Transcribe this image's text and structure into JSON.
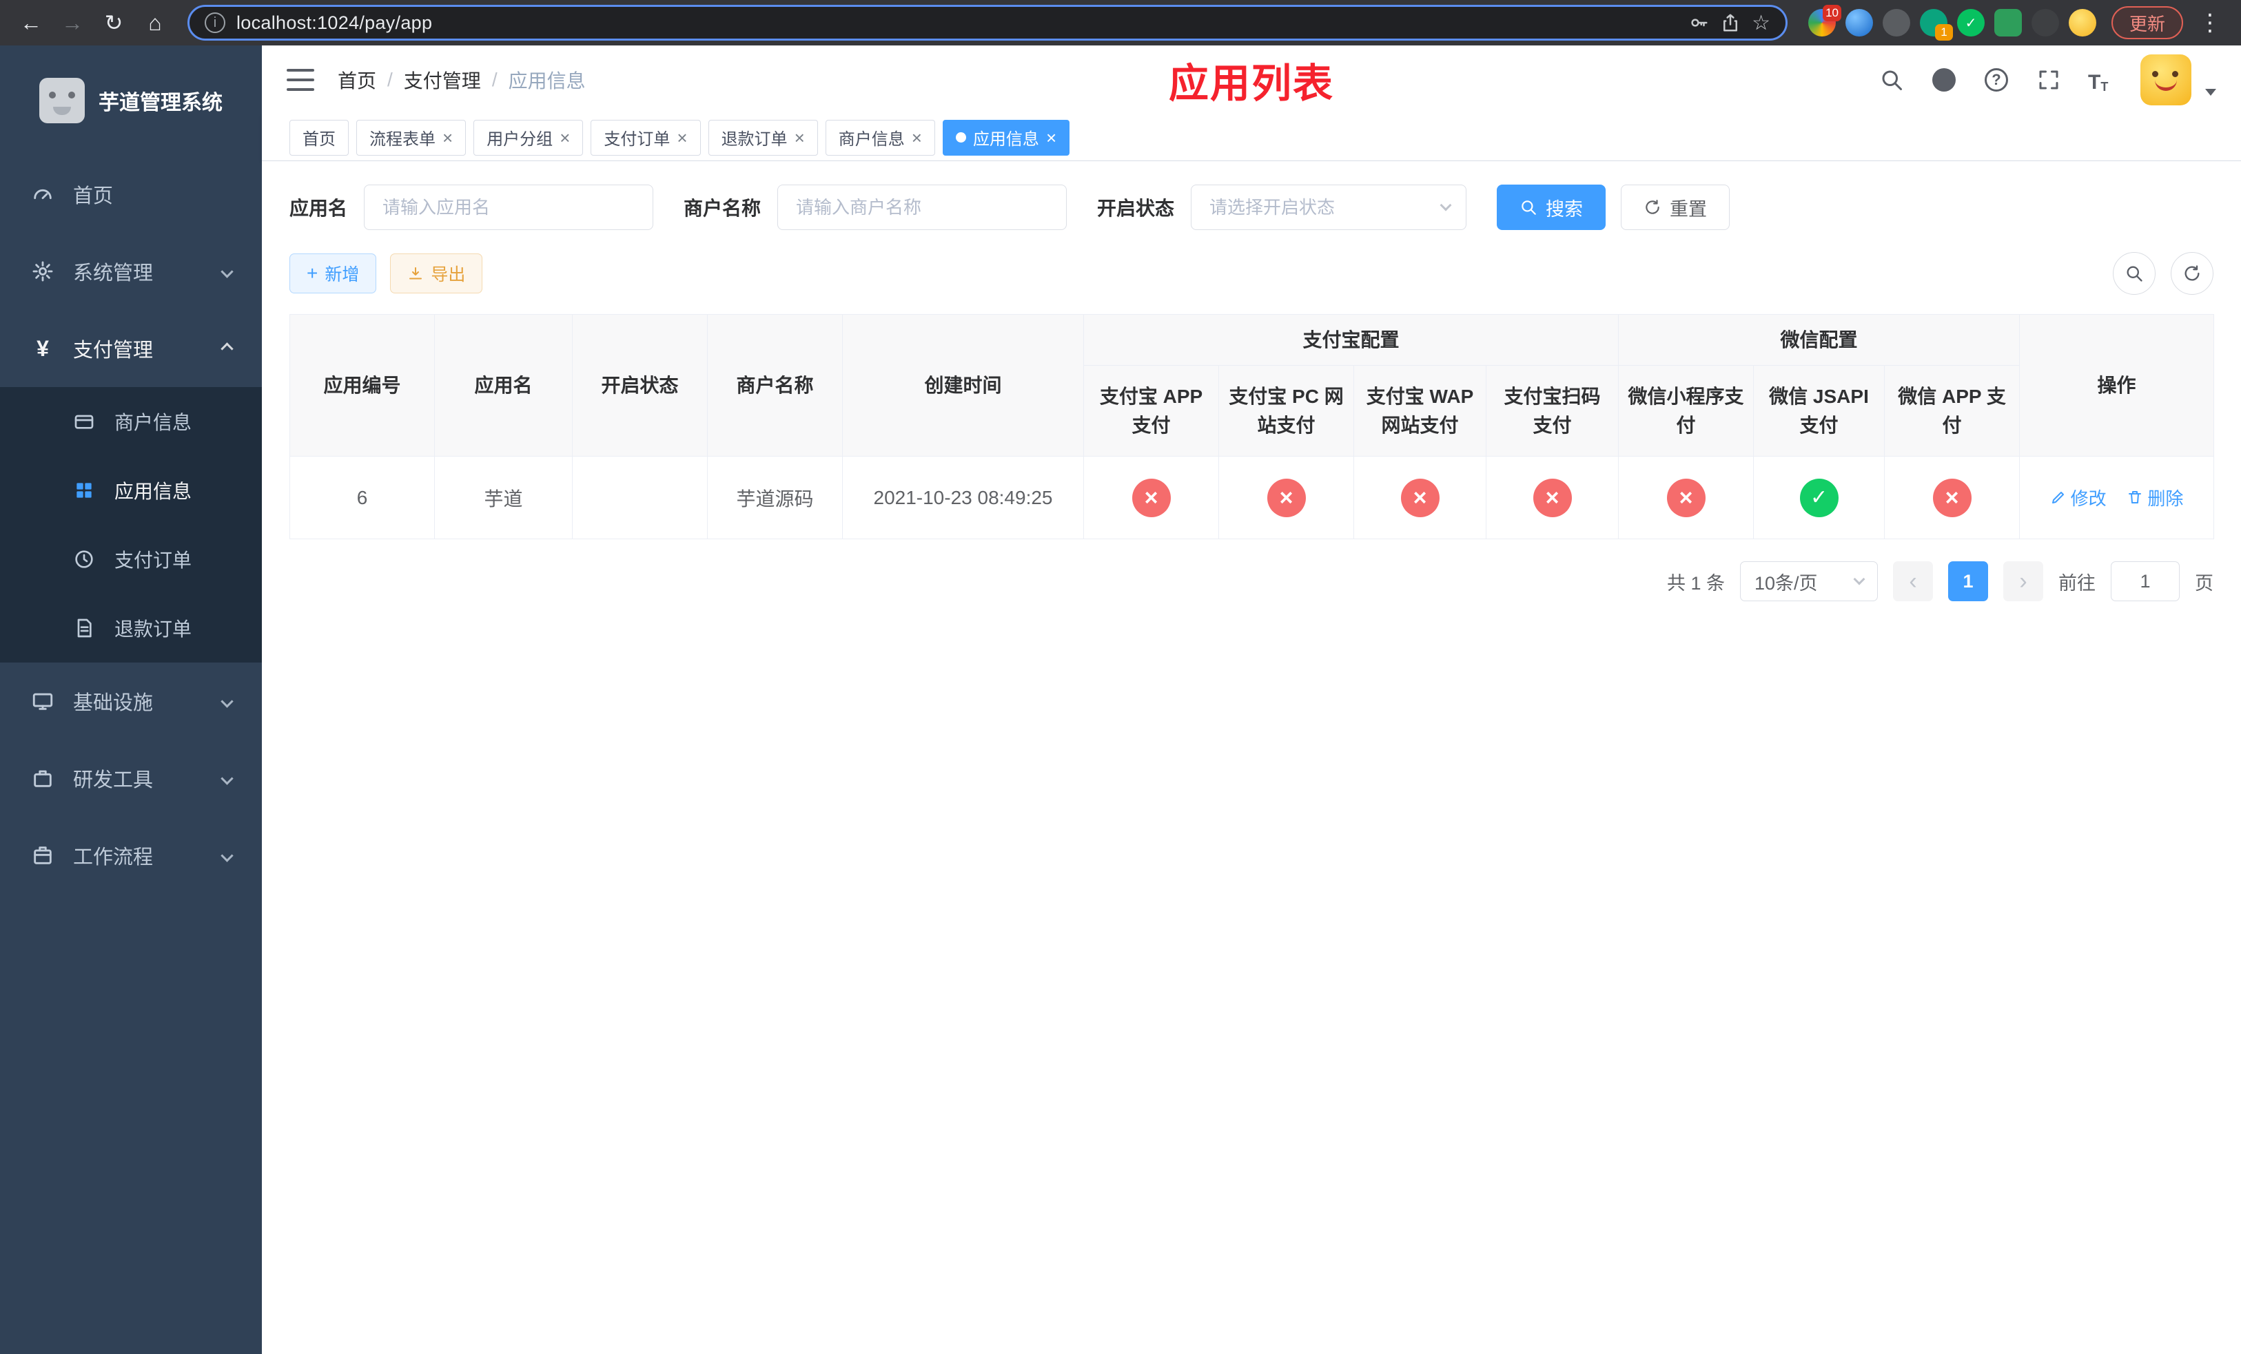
{
  "browser": {
    "url": "localhost:1024/pay/app",
    "update_label": "更新",
    "ext_badge_puzzle": "10",
    "ext_badge_green": "1"
  },
  "sidebar": {
    "app_title": "芋道管理系统",
    "menu": {
      "home": "首页",
      "system": "系统管理",
      "payment": "支付管理",
      "merchant": "商户信息",
      "app": "应用信息",
      "pay_order": "支付订单",
      "refund_order": "退款订单",
      "infra": "基础设施",
      "devtools": "研发工具",
      "workflow": "工作流程"
    }
  },
  "breadcrumb": {
    "home": "首页",
    "section": "支付管理",
    "current": "应用信息"
  },
  "page_title": "应用列表",
  "tabs": [
    {
      "label": "首页"
    },
    {
      "label": "流程表单"
    },
    {
      "label": "用户分组"
    },
    {
      "label": "支付订单"
    },
    {
      "label": "退款订单"
    },
    {
      "label": "商户信息"
    },
    {
      "label": "应用信息"
    }
  ],
  "filters": {
    "app_name_label": "应用名",
    "app_name_placeholder": "请输入应用名",
    "merchant_label": "商户名称",
    "merchant_placeholder": "请输入商户名称",
    "status_label": "开启状态",
    "status_placeholder": "请选择开启状态",
    "search_label": "搜索",
    "reset_label": "重置"
  },
  "toolbar": {
    "add_label": "新增",
    "export_label": "导出"
  },
  "table": {
    "columns": {
      "app_id": "应用编号",
      "app_name": "应用名",
      "status": "开启状态",
      "merchant_name": "商户名称",
      "created_at": "创建时间",
      "group_alipay": "支付宝配置",
      "group_wechat": "微信配置",
      "alipay_app": "支付宝 APP 支付",
      "alipay_pc": "支付宝 PC 网站支付",
      "alipay_wap": "支付宝 WAP 网站支付",
      "alipay_qr": "支付宝扫码支付",
      "wx_mini": "微信小程序支付",
      "wx_jsapi": "微信 JSAPI 支付",
      "wx_app": "微信 APP 支付",
      "actions": "操作"
    },
    "row": {
      "app_id": "6",
      "app_name": "芋道",
      "enabled": true,
      "merchant_name": "芋道源码",
      "created_at": "2021-10-23 08:49:25",
      "alipay_app": false,
      "alipay_pc": false,
      "alipay_wap": false,
      "alipay_qr": false,
      "wx_mini": false,
      "wx_jsapi": true,
      "wx_app": false,
      "edit_label": "修改",
      "delete_label": "删除"
    }
  },
  "pagination": {
    "total_text": "共 1 条",
    "page_size_text": "10条/页",
    "current_page": "1",
    "goto_label": "前往",
    "goto_value": "1",
    "page_unit": "页"
  },
  "colors": {
    "primary": "#409eff",
    "success": "#13ce66",
    "danger": "#f56c6c",
    "title_red": "#f5222d"
  }
}
